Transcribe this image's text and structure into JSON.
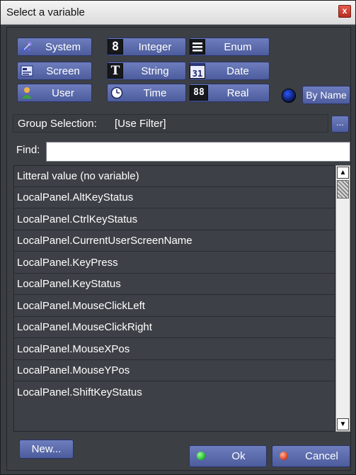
{
  "window": {
    "title": "Select a variable",
    "close_glyph": "x"
  },
  "type_buttons": {
    "system": {
      "label": "System",
      "icon": "molecule-icon"
    },
    "integer": {
      "label": "Integer",
      "icon": "digit-8-icon",
      "glyph": "8"
    },
    "enum": {
      "label": "Enum",
      "icon": "list-lines-icon"
    },
    "screen": {
      "label": "Screen",
      "icon": "screen-icon"
    },
    "string": {
      "label": "String",
      "icon": "letter-t-icon",
      "glyph": "T"
    },
    "date": {
      "label": "Date",
      "icon": "calendar-icon",
      "glyph": "31"
    },
    "user": {
      "label": "User",
      "icon": "user-icon"
    },
    "time": {
      "label": "Time",
      "icon": "clock-icon"
    },
    "real": {
      "label": "Real",
      "icon": "digits-88-icon",
      "glyph": "88"
    }
  },
  "by_name": {
    "label": "By Name"
  },
  "group": {
    "label": "Group Selection:",
    "value": "[Use Filter]",
    "button": "..."
  },
  "find": {
    "label": "Find:",
    "value": "",
    "placeholder": ""
  },
  "list": {
    "items": [
      "Litteral value (no variable)",
      "LocalPanel.AltKeyStatus",
      "LocalPanel.CtrlKeyStatus",
      "LocalPanel.CurrentUserScreenName",
      "LocalPanel.KeyPress",
      "LocalPanel.KeyStatus",
      "LocalPanel.MouseClickLeft",
      "LocalPanel.MouseClickRight",
      "LocalPanel.MouseXPos",
      "LocalPanel.MouseYPos",
      "LocalPanel.ShiftKeyStatus"
    ]
  },
  "buttons": {
    "new": "New...",
    "ok": "Ok",
    "cancel": "Cancel"
  },
  "colors": {
    "ok_dot": "#2ec43a",
    "cancel_dot": "#e14a2a",
    "accent": "#5b6aa8"
  }
}
